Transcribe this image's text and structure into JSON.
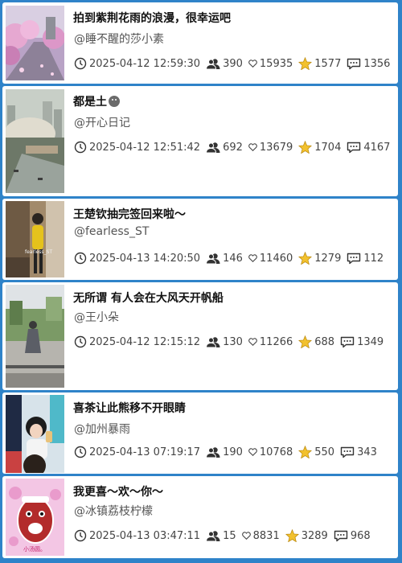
{
  "posts": [
    {
      "title": "拍到紫荆花雨的浪漫，很幸运吧",
      "author": "@睡不醒的莎小素",
      "time": "2025-04-12 12:59:30",
      "participants": "390",
      "likes": "15935",
      "favorites": "1577",
      "comments": "1356",
      "thumb_icon": "flower-street-icon"
    },
    {
      "title": "都是土",
      "author": "@开心日记",
      "time": "2025-04-12 12:51:42",
      "participants": "692",
      "likes": "13679",
      "favorites": "1704",
      "comments": "4167",
      "thumb_icon": "dust-city-icon"
    },
    {
      "title": "王楚钦抽完签回来啦～",
      "author": "@fearless_ST",
      "time": "2025-04-13 14:20:50",
      "participants": "146",
      "likes": "11460",
      "favorites": "1279",
      "comments": "112",
      "thumb_icon": "athlete-icon",
      "thumb_watermark": "fearless_ST"
    },
    {
      "title": "无所谓 有人会在大风天开帆船",
      "author": "@王小朵",
      "time": "2025-04-12 12:15:12",
      "participants": "130",
      "likes": "11266",
      "favorites": "688",
      "comments": "1349",
      "thumb_icon": "windy-park-icon"
    },
    {
      "title": "喜茶让此熊移不开眼睛",
      "author": "@加州暴雨",
      "time": "2025-04-13 07:19:17",
      "participants": "190",
      "likes": "10768",
      "favorites": "550",
      "comments": "343",
      "thumb_icon": "person-drink-icon"
    },
    {
      "title": "我更喜～欢～你～",
      "author": "@冰镇荔枝柠檬",
      "time": "2025-04-13 03:47:11",
      "participants": "15",
      "likes": "8831",
      "favorites": "3289",
      "comments": "968",
      "thumb_icon": "cartoon-sticker-icon",
      "thumb_watermark": "小汤圆。"
    }
  ],
  "colors": {
    "background": "#2f83c9",
    "star": "#f2c12e"
  }
}
